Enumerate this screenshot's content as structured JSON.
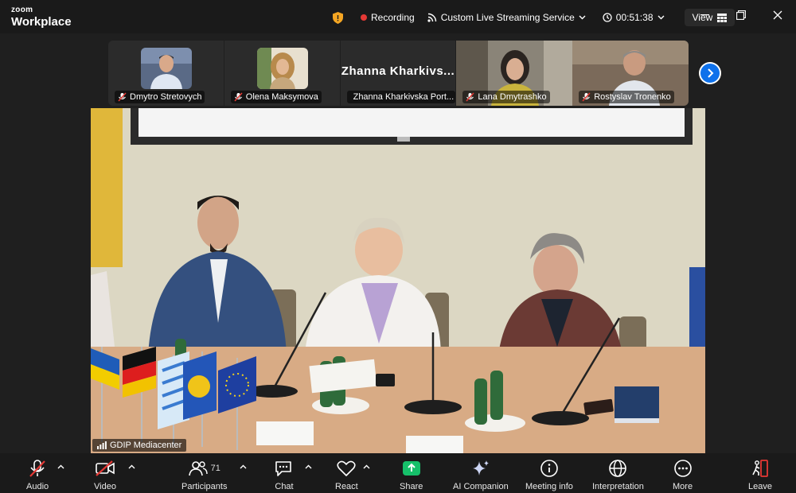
{
  "app": {
    "brand_top": "zoom",
    "brand_bottom": "Workplace"
  },
  "header": {
    "recording": "Recording",
    "streaming": "Custom Live Streaming Service",
    "timer": "00:51:38",
    "view": "View"
  },
  "participants_strip": [
    {
      "name": "Dmytro Stretovych",
      "muted": true
    },
    {
      "name": "Olena Maksymova",
      "muted": true
    },
    {
      "name": "Zhanna Kharkivska Port...",
      "display": "Zhanna  Kharkivs...",
      "muted": true
    },
    {
      "name": "Lana Dmytrashko",
      "muted": true
    },
    {
      "name": "Rostyslav Tronenko",
      "muted": true
    }
  ],
  "main_video": {
    "name": "GDIP Mediacenter"
  },
  "toolbar": {
    "audio": "Audio",
    "video": "Video",
    "participants": "Participants",
    "participants_count": "71",
    "chat": "Chat",
    "react": "React",
    "share": "Share",
    "ai": "AI Companion",
    "meeting_info": "Meeting info",
    "interpretation": "Interpretation",
    "more": "More",
    "leave": "Leave"
  },
  "colors": {
    "accent": "#0e71eb",
    "share": "#16c06a",
    "record": "#e53935",
    "mute": "#e53935"
  }
}
